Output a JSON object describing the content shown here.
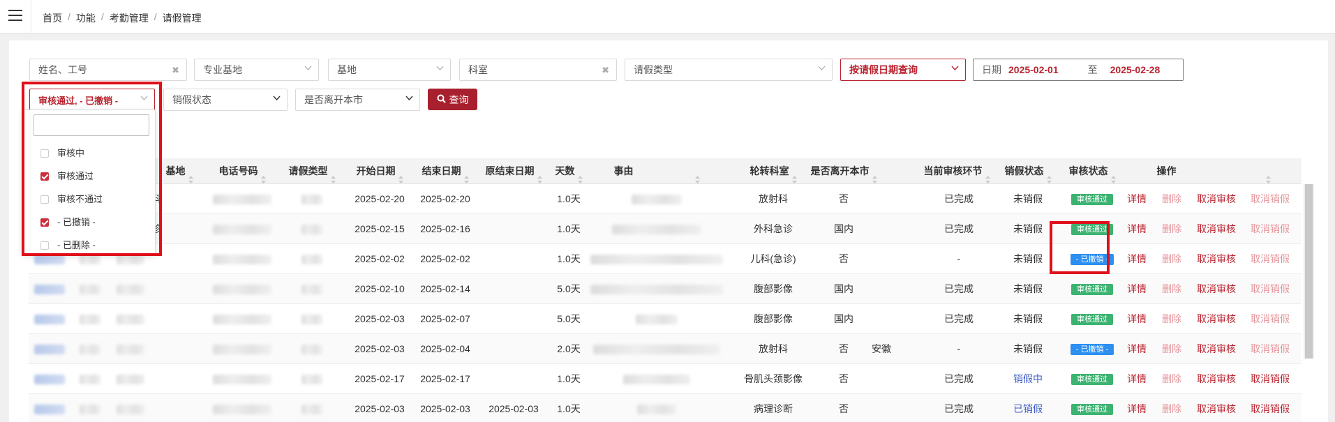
{
  "breadcrumb": [
    "首页",
    "功能",
    "考勤管理",
    "请假管理"
  ],
  "filters": {
    "name_placeholder": "姓名、工号",
    "specialty_base_placeholder": "专业基地",
    "base_placeholder": "基地",
    "department_placeholder": "科室",
    "leave_type_placeholder": "请假类型",
    "query_mode": "按请假日期查询",
    "date_label": "日期",
    "date_from": "2025-02-01",
    "date_to_label": "至",
    "date_to": "2025-02-28",
    "audit_status_selected": "审核通过, - 已撤销 -",
    "cancel_status_placeholder": "销假状态",
    "left_city_placeholder": "是否离开本市",
    "query_button": "查询"
  },
  "audit_dropdown": {
    "options": [
      {
        "label": "审核中",
        "checked": false
      },
      {
        "label": "审核通过",
        "checked": true
      },
      {
        "label": "审核不通过",
        "checked": false
      },
      {
        "label": "- 已撤销 -",
        "checked": true
      },
      {
        "label": "- 已删除 -",
        "checked": false
      }
    ]
  },
  "table": {
    "columns": [
      "基地",
      "电话号码",
      "请假类型",
      "开始日期",
      "结束日期",
      "原结束日期",
      "天数",
      "事由",
      "轮转科室",
      "是否离开本市",
      "当前审核环节",
      "销假状态",
      "审核状态",
      "操作"
    ],
    "rows": [
      {
        "base": "科",
        "start": "2025-02-20",
        "end": "2025-02-20",
        "orig_end": "",
        "days": "1.0天",
        "dept": "放射科",
        "left": "否",
        "city": "",
        "step": "已完成",
        "cancel": "未销假",
        "status": "审核通过",
        "status_color": "green"
      },
      {
        "base": "诊",
        "start": "2025-02-15",
        "end": "2025-02-16",
        "orig_end": "",
        "days": "1.0天",
        "dept": "外科急诊",
        "left": "国内",
        "city": "",
        "step": "已完成",
        "cancel": "未销假",
        "status": "审核通过",
        "status_color": "green"
      },
      {
        "base": "",
        "start": "2025-02-02",
        "end": "2025-02-02",
        "orig_end": "",
        "days": "1.0天",
        "dept": "儿科(急诊)",
        "left": "否",
        "city": "",
        "step": "-",
        "cancel": "未销假",
        "status": "- 已撤销 -",
        "status_color": "blue"
      },
      {
        "base": "",
        "start": "2025-02-10",
        "end": "2025-02-14",
        "orig_end": "",
        "days": "5.0天",
        "dept": "腹部影像",
        "left": "国内",
        "city": "",
        "step": "已完成",
        "cancel": "未销假",
        "status": "审核通过",
        "status_color": "green"
      },
      {
        "base": "",
        "start": "2025-02-03",
        "end": "2025-02-07",
        "orig_end": "",
        "days": "5.0天",
        "dept": "腹部影像",
        "left": "国内",
        "city": "",
        "step": "已完成",
        "cancel": "未销假",
        "status": "审核通过",
        "status_color": "green"
      },
      {
        "base": "",
        "start": "2025-02-03",
        "end": "2025-02-04",
        "orig_end": "",
        "days": "2.0天",
        "dept": "放射科",
        "left": "否",
        "city": "安徽",
        "step": "-",
        "cancel": "未销假",
        "status": "- 已撤销 -",
        "status_color": "blue"
      },
      {
        "base": "",
        "start": "2025-02-17",
        "end": "2025-02-17",
        "orig_end": "",
        "days": "1.0天",
        "dept": "骨肌头颈影像",
        "left": "否",
        "city": "",
        "step": "已完成",
        "cancel": "销假中",
        "status": "审核通过",
        "status_color": "green"
      },
      {
        "base": "",
        "start": "2025-02-03",
        "end": "2025-02-03",
        "orig_end": "2025-02-03",
        "days": "1.0天",
        "dept": "病理诊断",
        "left": "否",
        "city": "",
        "step": "已完成",
        "cancel": "已销假",
        "status": "审核通过",
        "status_color": "green"
      }
    ],
    "actions": {
      "detail": "详情",
      "delete": "删除",
      "cancel_audit": "取消审核",
      "cancel_leave": "取消销假"
    }
  },
  "colors": {
    "accent": "#a8202e",
    "green_badge": "#3cb371",
    "blue_badge": "#2d8ff0",
    "highlight": "#e0101a"
  }
}
